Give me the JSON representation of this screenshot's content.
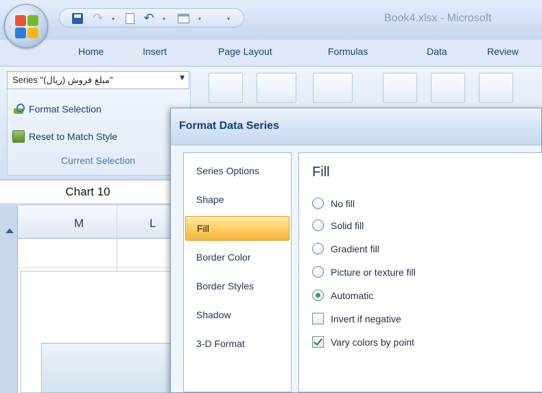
{
  "window": {
    "title": "Book4.xlsx - Microsoft"
  },
  "ribbon": {
    "tabs": [
      "Home",
      "Insert",
      "Page Layout",
      "Formulas",
      "Data",
      "Review"
    ],
    "current_selection": {
      "series_value": "Series \"مبلغ فروش (ریال)\"",
      "format_selection": "Format Selection",
      "reset_to_match_style": "Reset to Match Style",
      "group_label": "Current Selection"
    }
  },
  "sheet": {
    "name_box": "Chart 10",
    "columns": [
      "M",
      "L"
    ]
  },
  "dialog": {
    "title": "Format Data Series",
    "nav": [
      "Series Options",
      "Shape",
      "Fill",
      "Border Color",
      "Border Styles",
      "Shadow",
      "3-D Format"
    ],
    "active_nav": "Fill",
    "panel": {
      "heading": "Fill",
      "options": [
        {
          "label": "No fill",
          "type": "radio",
          "checked": false
        },
        {
          "label": "Solid fill",
          "type": "radio",
          "checked": false
        },
        {
          "label": "Gradient fill",
          "type": "radio",
          "checked": false
        },
        {
          "label": "Picture or texture fill",
          "type": "radio",
          "checked": false
        },
        {
          "label": "Automatic",
          "type": "radio",
          "checked": true
        },
        {
          "label": "Invert if negative",
          "type": "checkbox",
          "checked": false
        },
        {
          "label": "Vary colors by point",
          "type": "checkbox",
          "checked": true
        }
      ]
    }
  },
  "icons": {
    "office_button": "office-logo-icon",
    "save": "save-icon",
    "redo": "redo-icon",
    "new": "new-document-icon",
    "undo": "undo-icon",
    "print_preview": "print-preview-icon"
  }
}
